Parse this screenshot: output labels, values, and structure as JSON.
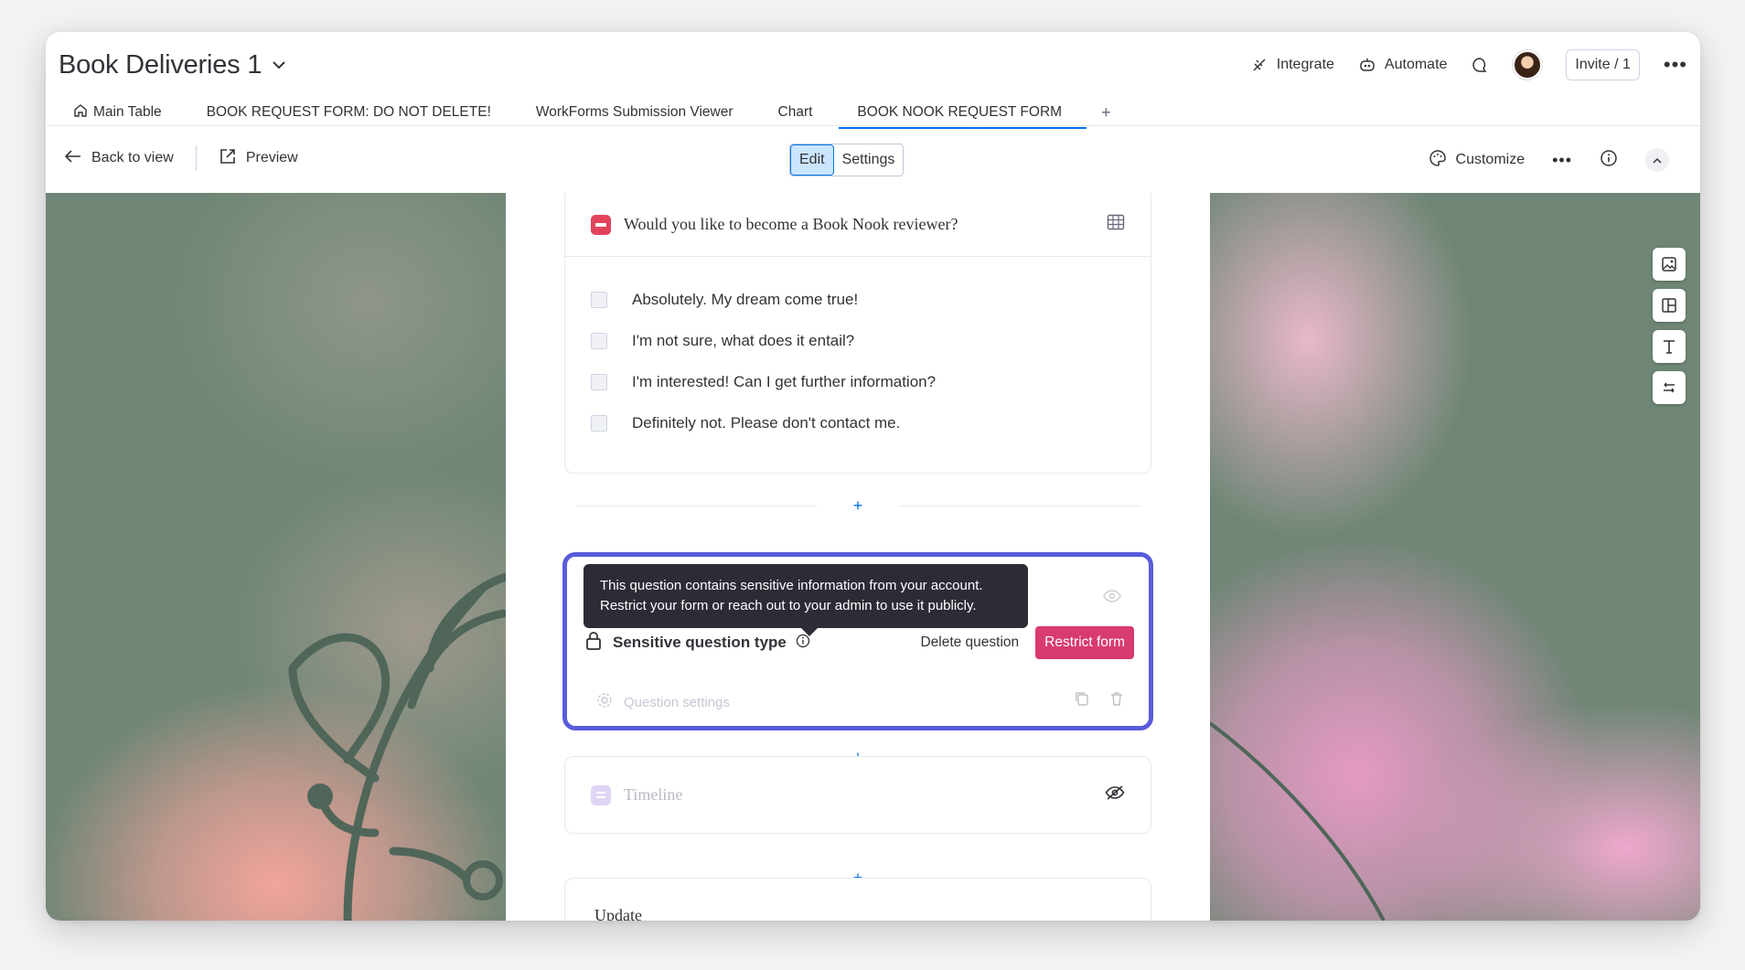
{
  "board": {
    "title": "Book Deliveries 1"
  },
  "header": {
    "integrate_label": "Integrate",
    "automate_label": "Automate",
    "invite_label": "Invite / 1"
  },
  "tabs": [
    {
      "label": "Main Table"
    },
    {
      "label": "BOOK REQUEST FORM: DO NOT DELETE!"
    },
    {
      "label": "WorkForms Submission Viewer"
    },
    {
      "label": "Chart"
    },
    {
      "label": "BOOK NOOK REQUEST FORM",
      "active": true
    }
  ],
  "tab_add": "+",
  "toolbar": {
    "back_label": "Back to view",
    "preview_label": "Preview",
    "edit_label": "Edit",
    "settings_label": "Settings",
    "customize_label": "Customize"
  },
  "form": {
    "question": {
      "title": "Would you like to become a Book Nook reviewer?",
      "options": [
        "Absolutely. My dream come true!",
        "I'm not sure, what does it entail?",
        "I'm interested! Can I get further information?",
        "Definitely not. Please don't contact me."
      ]
    },
    "adder_symbol": "+",
    "sensitive": {
      "tooltip_line1": "This question contains sensitive information from your account.",
      "tooltip_line2": "Restrict your form or reach out to your admin to use it publicly.",
      "label": "Sensitive question type",
      "delete_label": "Delete question",
      "restrict_label": "Restrict form",
      "settings_label": "Question settings"
    },
    "timeline": {
      "title": "Timeline"
    },
    "update": {
      "title": "Update"
    }
  },
  "colors": {
    "accent": "#0073ea",
    "selection_border": "#5a5cdb",
    "restrict_button": "#d83a72",
    "question_type_badge": "#e2445c",
    "tooltip_bg": "#2b2c36"
  }
}
